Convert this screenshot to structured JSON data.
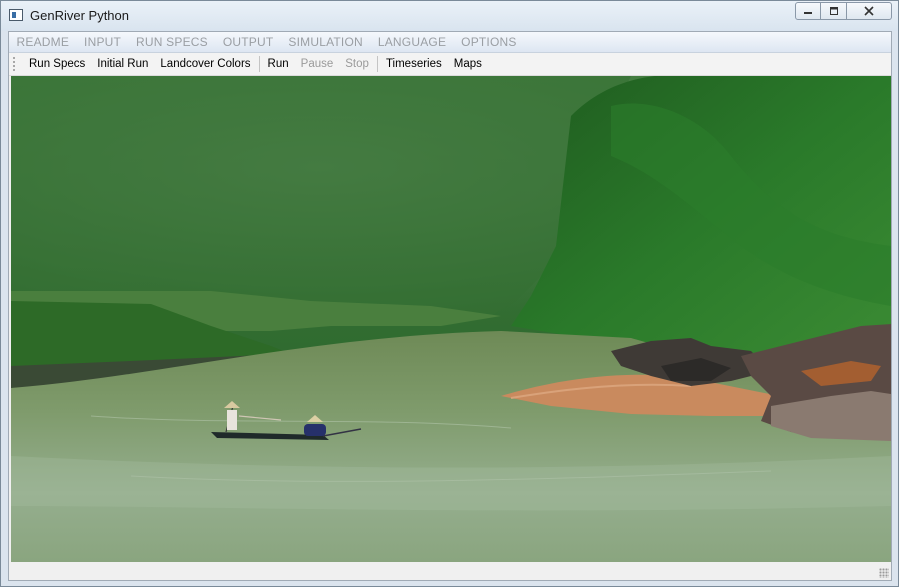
{
  "window": {
    "title": "GenRiver Python",
    "icon": "app-icon",
    "controls": {
      "minimize": "minimize-icon",
      "maximize": "maximize-icon",
      "close": "close-icon"
    }
  },
  "menu": [
    "README",
    "INPUT",
    "RUN SPECS",
    "OUTPUT",
    "SIMULATION",
    "LANGUAGE",
    "OPTIONS"
  ],
  "toolbar": {
    "run_specs": "Run Specs",
    "initial_run": "Initial Run",
    "landcover_colors": "Landcover Colors",
    "run": "Run",
    "pause": "Pause",
    "stop": "Stop",
    "timeseries": "Timeseries",
    "maps": "Maps"
  },
  "content": {
    "image": "river-landscape-photo"
  }
}
